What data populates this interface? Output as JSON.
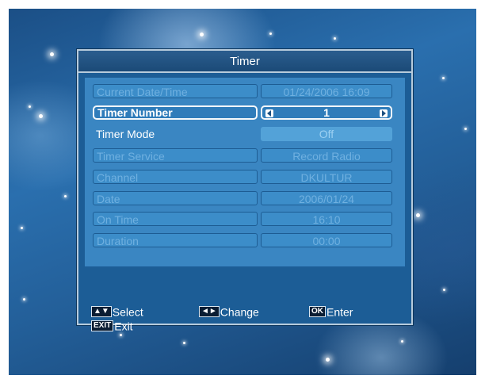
{
  "title": "Timer",
  "rows": [
    {
      "label": "Current Date/Time",
      "value": "01/24/2006 16:09"
    },
    {
      "label": "Timer Number",
      "value": "1"
    },
    {
      "label": "Timer Mode",
      "value": "Off"
    },
    {
      "label": "Timer Service",
      "value": "Record Radio"
    },
    {
      "label": "Channel",
      "value": "DKULTUR"
    },
    {
      "label": "Date",
      "value": "2006/01/24"
    },
    {
      "label": "On Time",
      "value": "16:10"
    },
    {
      "label": "Duration",
      "value": "00:00"
    }
  ],
  "footer": {
    "select_key": "▲▼",
    "select_label": "Select",
    "change_key": "◄►",
    "change_label": "Change",
    "ok_key": "OK",
    "ok_label": "Enter",
    "exit_key": "EXIT",
    "exit_label": "Exit"
  },
  "icons": {
    "left_arrow": "arrow-left-icon",
    "right_arrow": "arrow-right-icon",
    "star": "star-icon"
  },
  "colors": {
    "panel": "#1c5d96",
    "content": "#3a86c2",
    "highlight_border": "#f4f8fb"
  }
}
